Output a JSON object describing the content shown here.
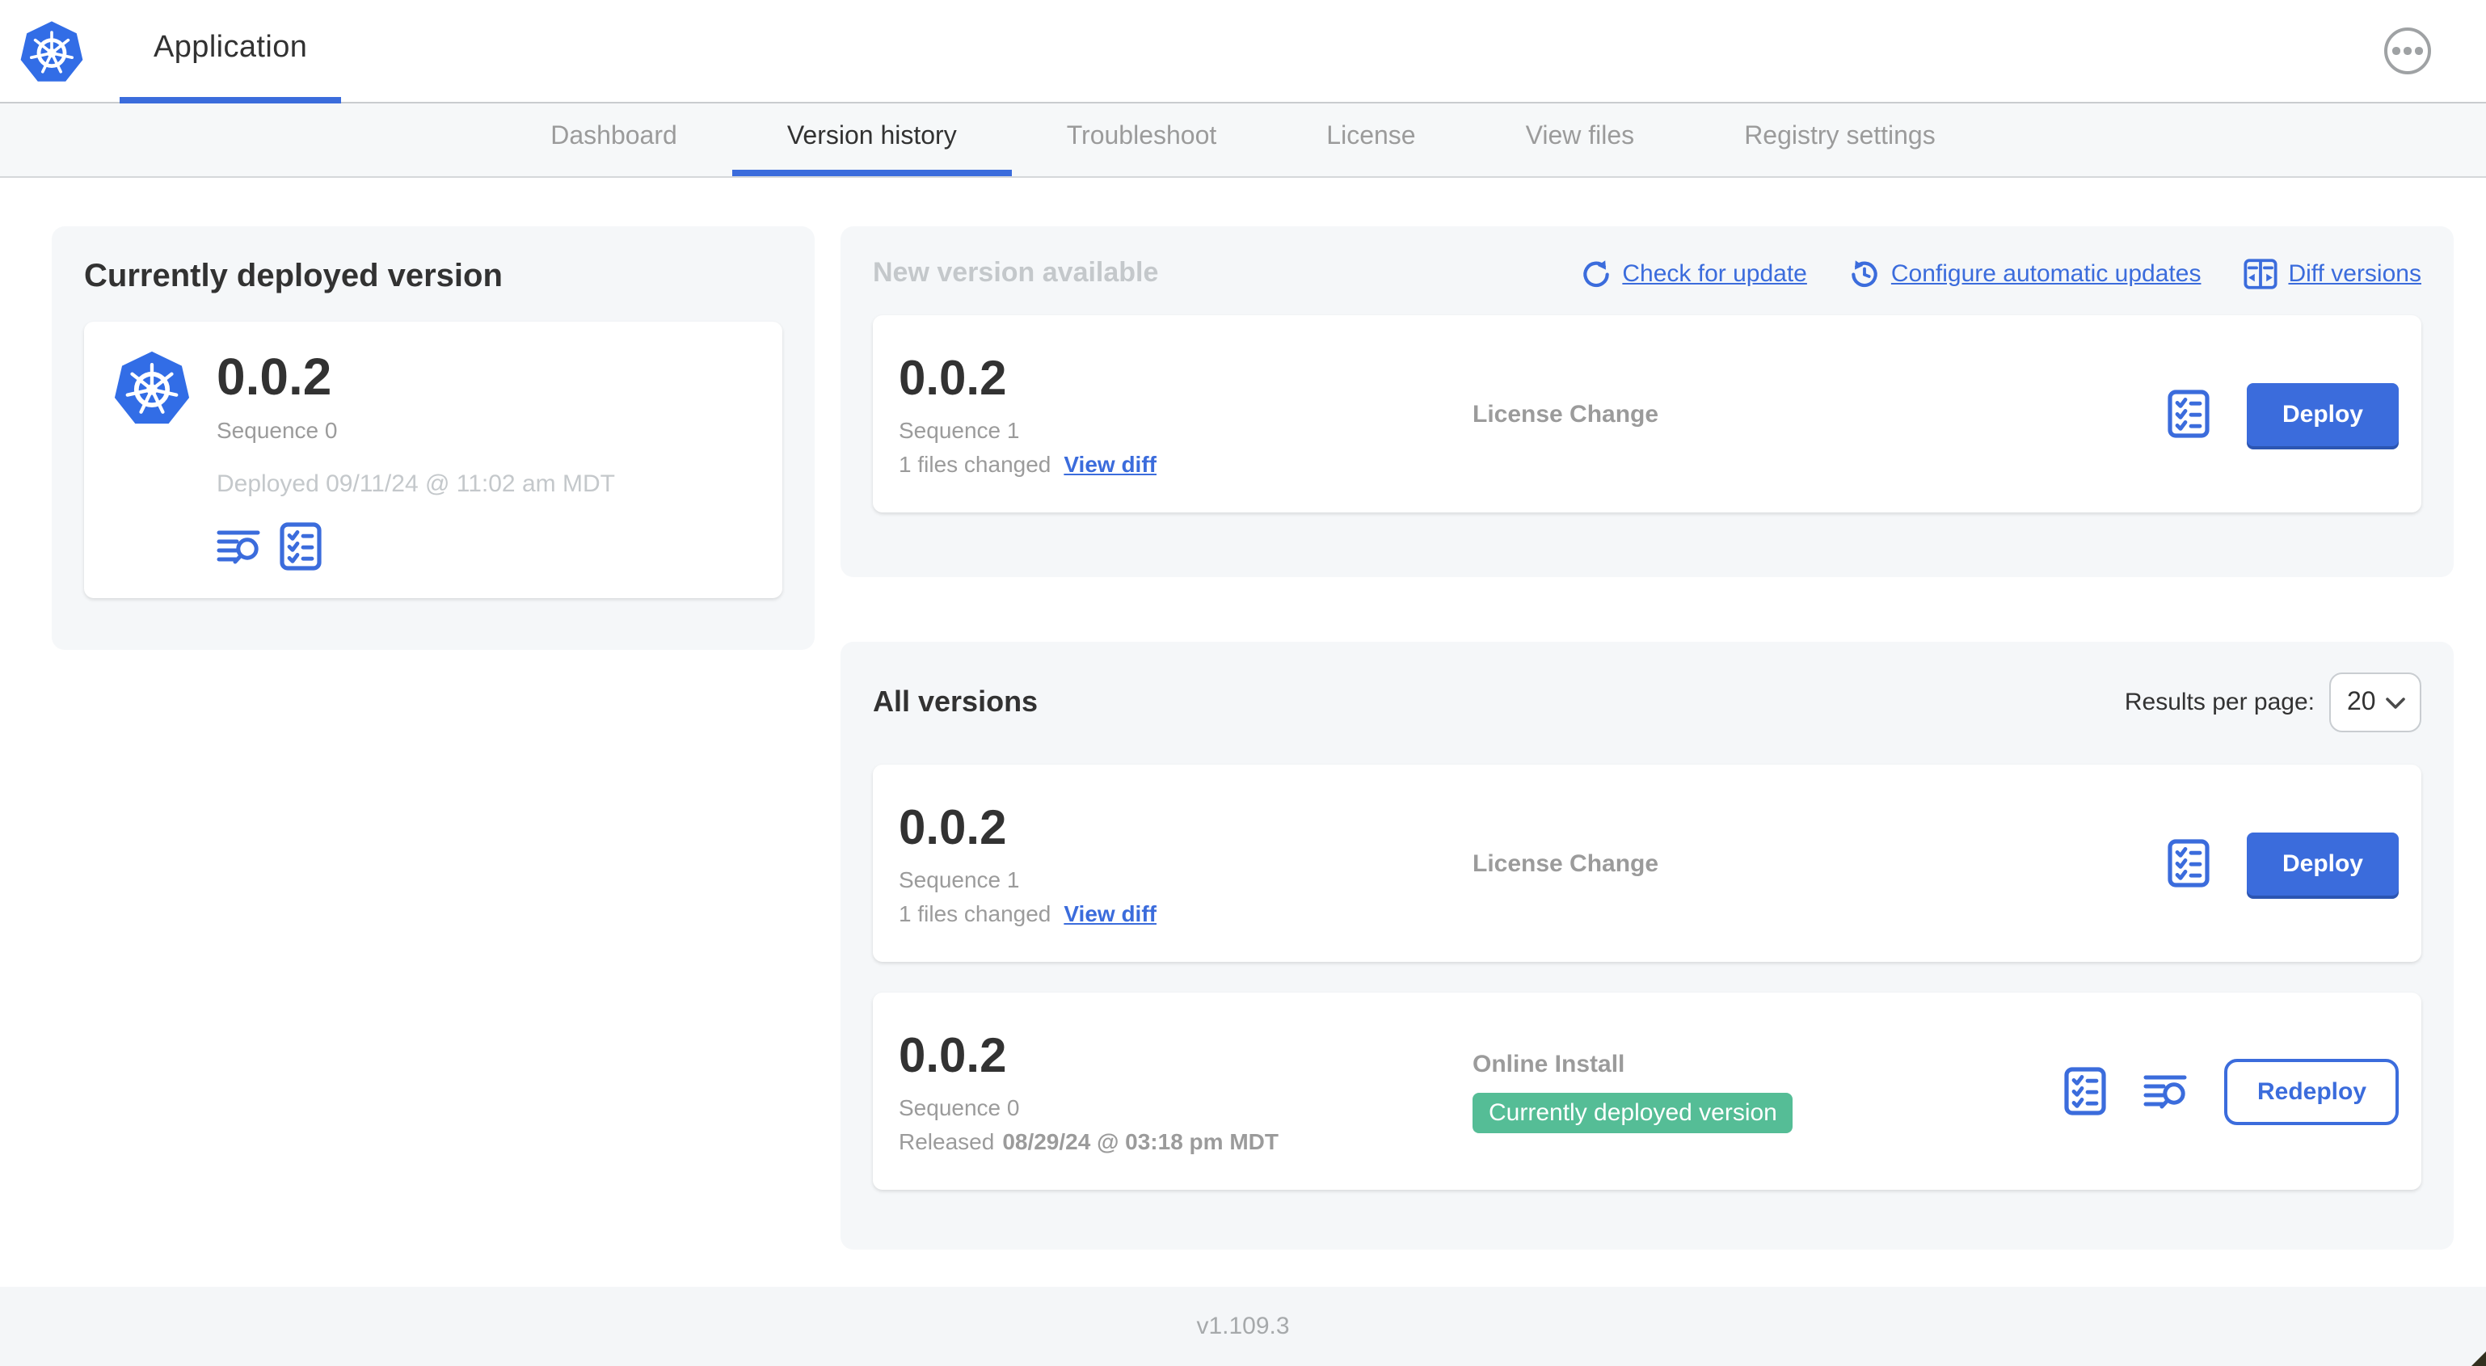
{
  "app": {
    "title": "Application",
    "footer_version": "v1.109.3"
  },
  "nav": {
    "tabs": [
      "Dashboard",
      "Version history",
      "Troubleshoot",
      "License",
      "View files",
      "Registry settings"
    ],
    "active_tab": "Version history"
  },
  "colors": {
    "accent_blue": "#3b6cdc",
    "k8s_blue": "#326de6",
    "badge_green": "#55bd96",
    "dark_text": "#323232",
    "gray_text": "#9b9b9b",
    "light_text": "#c4c8cb"
  },
  "current_version": {
    "panel_title": "Currently deployed version",
    "version": "0.0.2",
    "sequence": "Sequence 0",
    "deployed": "Deployed 09/11/24 @ 11:02 am MDT"
  },
  "new_version": {
    "panel_title": "New version available",
    "check_for_update": "Check for update",
    "configure_automatic_updates": "Configure automatic updates",
    "diff_versions": "Diff versions",
    "card": {
      "version": "0.0.2",
      "sequence": "Sequence 1",
      "files_changed": "1 files changed",
      "view_diff": "View diff",
      "source": "License Change",
      "action": "Deploy"
    }
  },
  "all_versions": {
    "panel_title": "All versions",
    "results_per_page_label": "Results per page:",
    "results_per_page_value": "20",
    "rows": [
      {
        "version": "0.0.2",
        "sequence": "Sequence 1",
        "files_changed": "1 files changed",
        "view_diff": "View diff",
        "source": "License Change",
        "action": "Deploy"
      },
      {
        "version": "0.0.2",
        "sequence": "Sequence 0",
        "released_prefix": "Released",
        "released_date": "08/29/24 @ 03:18 pm MDT",
        "source": "Online Install",
        "badge": "Currently deployed version",
        "action": "Redeploy"
      }
    ]
  }
}
